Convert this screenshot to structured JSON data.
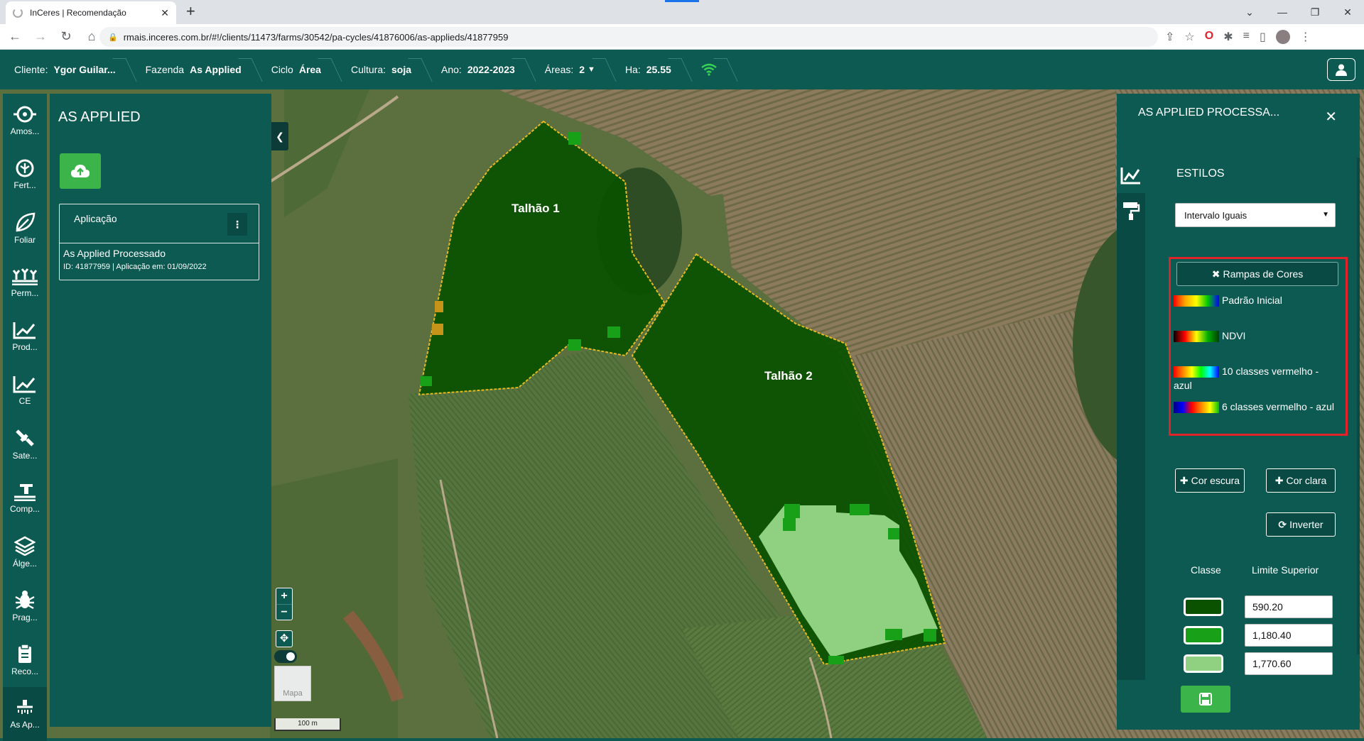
{
  "browser": {
    "tab_title": "InCeres | Recomendação",
    "url": "rmais.inceres.com.br/#!/clients/11473/farms/30542/pa-cycles/41876006/as-applieds/41877959"
  },
  "header": {
    "client_label": "Cliente:",
    "client_value": "Ygor Guilar...",
    "farm_label": "Fazenda",
    "farm_value": "As Applied",
    "cycle_label": "Ciclo",
    "cycle_value": "Área",
    "crop_label": "Cultura:",
    "crop_value": "soja",
    "year_label": "Ano:",
    "year_value": "2022-2023",
    "areas_label": "Áreas:",
    "areas_value": "2",
    "ha_label": "Ha:",
    "ha_value": "25.55"
  },
  "rail": {
    "items": [
      {
        "label": "Amos...",
        "icon": "sampling-icon"
      },
      {
        "label": "Fert...",
        "icon": "fertility-icon"
      },
      {
        "label": "Foliar",
        "icon": "leaf-icon"
      },
      {
        "label": "Perm...",
        "icon": "permanent-crop-icon"
      },
      {
        "label": "Prod...",
        "icon": "productivity-chart-icon"
      },
      {
        "label": "CE",
        "icon": "conductivity-chart-icon"
      },
      {
        "label": "Sate...",
        "icon": "satellite-icon"
      },
      {
        "label": "Comp...",
        "icon": "compaction-icon"
      },
      {
        "label": "Álge...",
        "icon": "layers-icon"
      },
      {
        "label": "Prag...",
        "icon": "bug-icon"
      },
      {
        "label": "Reco...",
        "icon": "recommendation-icon"
      },
      {
        "label": "As Ap...",
        "icon": "sprayer-icon"
      }
    ]
  },
  "left_panel": {
    "title": "AS APPLIED",
    "card_header": "Aplicação",
    "item_name": "As Applied Processado",
    "item_meta": "ID: 41877959 | Aplicação em: 01/09/2022"
  },
  "map": {
    "field1_label": "Talhão 1",
    "field2_label": "Talhão 2",
    "zoom_in": "+",
    "zoom_out": "−",
    "thumb_label": "Mapa",
    "scale": "100 m",
    "colors": {
      "dark_green": "#0a5200",
      "mid_green": "#18a018",
      "light_green": "#8fd081",
      "orange": "#c7941a"
    }
  },
  "right_panel": {
    "title": "AS APPLIED PROCESSA...",
    "section_title": "ESTILOS",
    "style_select_value": "Intervalo Iguais",
    "ramps_header": "Rampas de Cores",
    "ramps": [
      {
        "label": "Padrão Inicial",
        "gradient": "linear-gradient(90deg,#ff0000,#ffa500,#ffff00,#00c800,#0000ff)"
      },
      {
        "label": "NDVI",
        "gradient": "linear-gradient(90deg,#000000,#ff0000,#ffff00,#00b000,#004000)"
      },
      {
        "label": "10 classes vermelho - azul",
        "gradient": "linear-gradient(90deg,#ff0000,#ff8000,#ffff00,#00ff00,#00ffff,#0000ff)"
      },
      {
        "label": "6 classes vermelho - azul",
        "gradient": "linear-gradient(90deg,#000080,#0000ff,#ff0000,#ff8000,#ffff00,#00c000)"
      }
    ],
    "dark_color_btn": "Cor escura",
    "light_color_btn": "Cor clara",
    "invert_btn": "Inverter",
    "class_header": "Classe",
    "limit_header": "Limite Superior",
    "classes": [
      {
        "color": "#0a5200",
        "limit": "590.20"
      },
      {
        "color": "#18a018",
        "limit": "1,180.40"
      },
      {
        "color": "#8fd081",
        "limit": "1,770.60"
      }
    ]
  }
}
